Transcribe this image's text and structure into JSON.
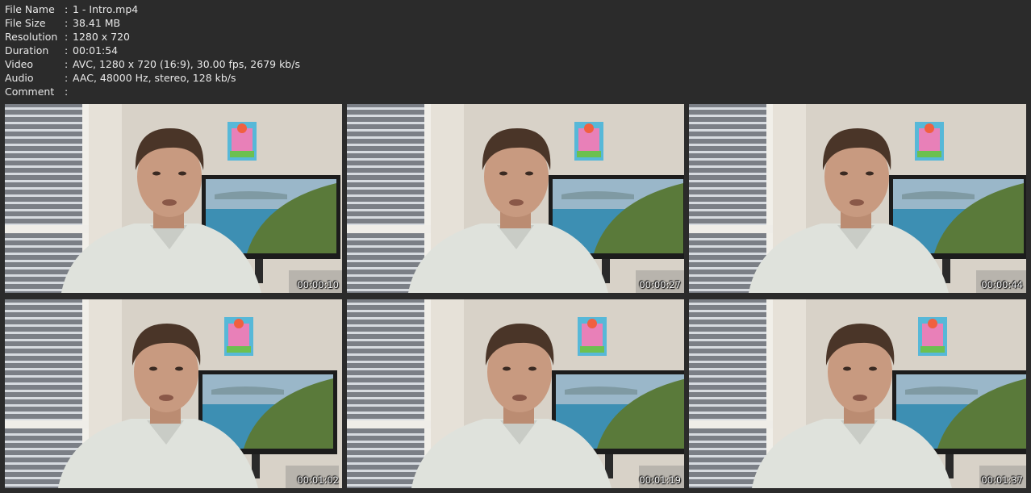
{
  "file_info": [
    {
      "key": "File Name",
      "sep": ":",
      "value": "1 - Intro.mp4"
    },
    {
      "key": "File Size",
      "sep": ":",
      "value": "38.41 MB"
    },
    {
      "key": "Resolution",
      "sep": ":",
      "value": "1280 x 720"
    },
    {
      "key": "Duration",
      "sep": ":",
      "value": "00:01:54"
    },
    {
      "key": "Video",
      "sep": ":",
      "value": "AVC, 1280 x 720 (16:9), 30.00 fps, 2679 kb/s"
    },
    {
      "key": "Audio",
      "sep": ":",
      "value": "AAC, 48000 Hz, stereo, 128 kb/s"
    },
    {
      "key": "Comment",
      "sep": ":",
      "value": ""
    }
  ],
  "thumbnails": [
    {
      "timestamp": "00:00:10"
    },
    {
      "timestamp": "00:00:27"
    },
    {
      "timestamp": "00:00:44"
    },
    {
      "timestamp": "00:01:02"
    },
    {
      "timestamp": "00:01:19"
    },
    {
      "timestamp": "00:01:37"
    }
  ],
  "colors": {
    "background": "#2b2b2b",
    "text": "#e8e8e8",
    "wall": "#d8d2c8",
    "shirt": "#dfe2dc",
    "skin": "#c89a80",
    "hair": "#4a3528",
    "monitor_frame": "#1c1c1c",
    "sea": "#3d8fb3",
    "hill": "#5a7a3a"
  }
}
